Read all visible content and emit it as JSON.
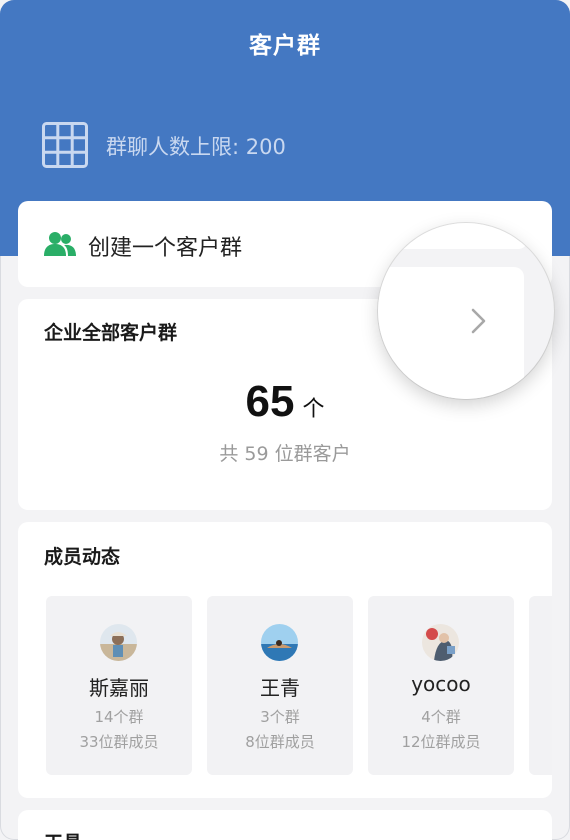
{
  "header": {
    "title": "客户群",
    "limit_text": "群聊人数上限: 200",
    "bg_color": "#4478c2"
  },
  "create": {
    "label": "创建一个客户群",
    "icon": "users-icon",
    "icon_color": "#2aae67"
  },
  "all_groups": {
    "title": "企业全部客户群",
    "count": "65",
    "unit": "个",
    "total": "共 59 位群客户"
  },
  "members": {
    "title": "成员动态",
    "items": [
      {
        "name": "斯嘉丽",
        "groups": "14个群",
        "members": "33位群成员"
      },
      {
        "name": "王青",
        "groups": "3个群",
        "members": "8位群成员"
      },
      {
        "name": "yocoo",
        "groups": "4个群",
        "members": "12位群成员"
      }
    ]
  },
  "tools": {
    "title": "工具"
  }
}
